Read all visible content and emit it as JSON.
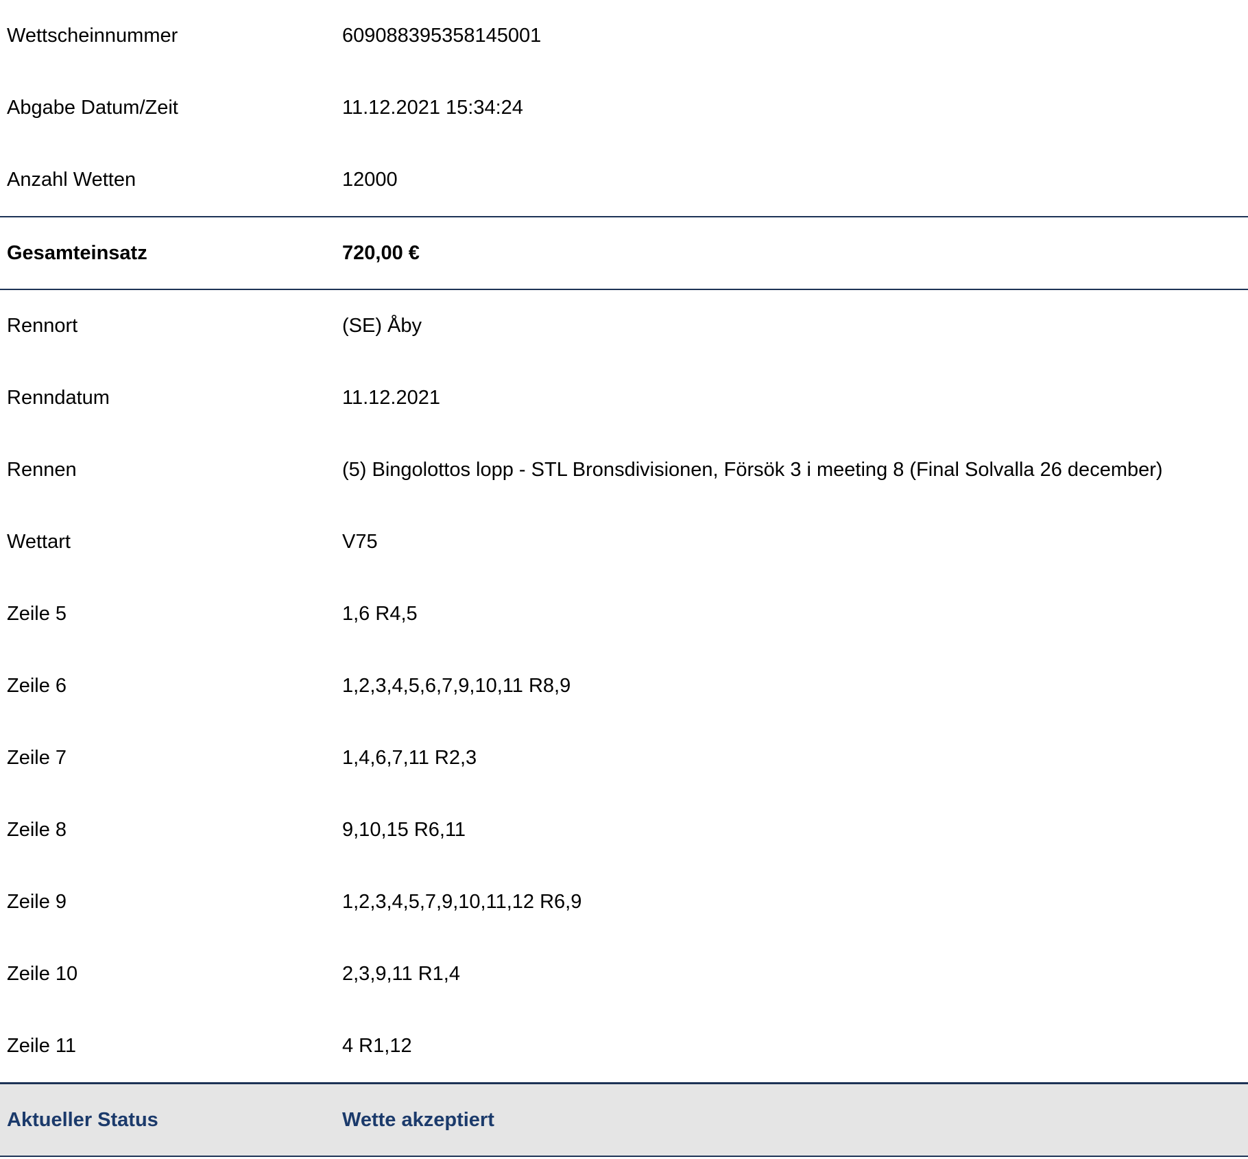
{
  "header_rows": [
    {
      "label": "Wettscheinnummer",
      "value": "609088395358145001"
    },
    {
      "label": "Abgabe Datum/Zeit",
      "value": "11.12.2021 15:34:24"
    },
    {
      "label": "Anzahl Wetten",
      "value": "12000"
    }
  ],
  "total": {
    "label": "Gesamteinsatz",
    "value": "720,00 €"
  },
  "detail_rows": [
    {
      "label": "Rennort",
      "value": "(SE) Åby"
    },
    {
      "label": "Renndatum",
      "value": "11.12.2021"
    },
    {
      "label": "Rennen",
      "value": "(5) Bingolottos lopp - STL Bronsdivisionen, Försök 3 i meeting 8 (Final Solvalla 26 december)"
    },
    {
      "label": "Wettart",
      "value": "V75"
    },
    {
      "label": "Zeile 5",
      "value": "1,6 R4,5"
    },
    {
      "label": "Zeile 6",
      "value": "1,2,3,4,5,6,7,9,10,11 R8,9"
    },
    {
      "label": "Zeile 7",
      "value": "1,4,6,7,11 R2,3"
    },
    {
      "label": "Zeile 8",
      "value": "9,10,15 R6,11"
    },
    {
      "label": "Zeile 9",
      "value": "1,2,3,4,5,7,9,10,11,12 R6,9"
    },
    {
      "label": "Zeile 10",
      "value": "2,3,9,11 R1,4"
    },
    {
      "label": "Zeile 11",
      "value": "4 R1,12"
    }
  ],
  "status": {
    "label": "Aktueller Status",
    "value": "Wette akzeptiert"
  }
}
